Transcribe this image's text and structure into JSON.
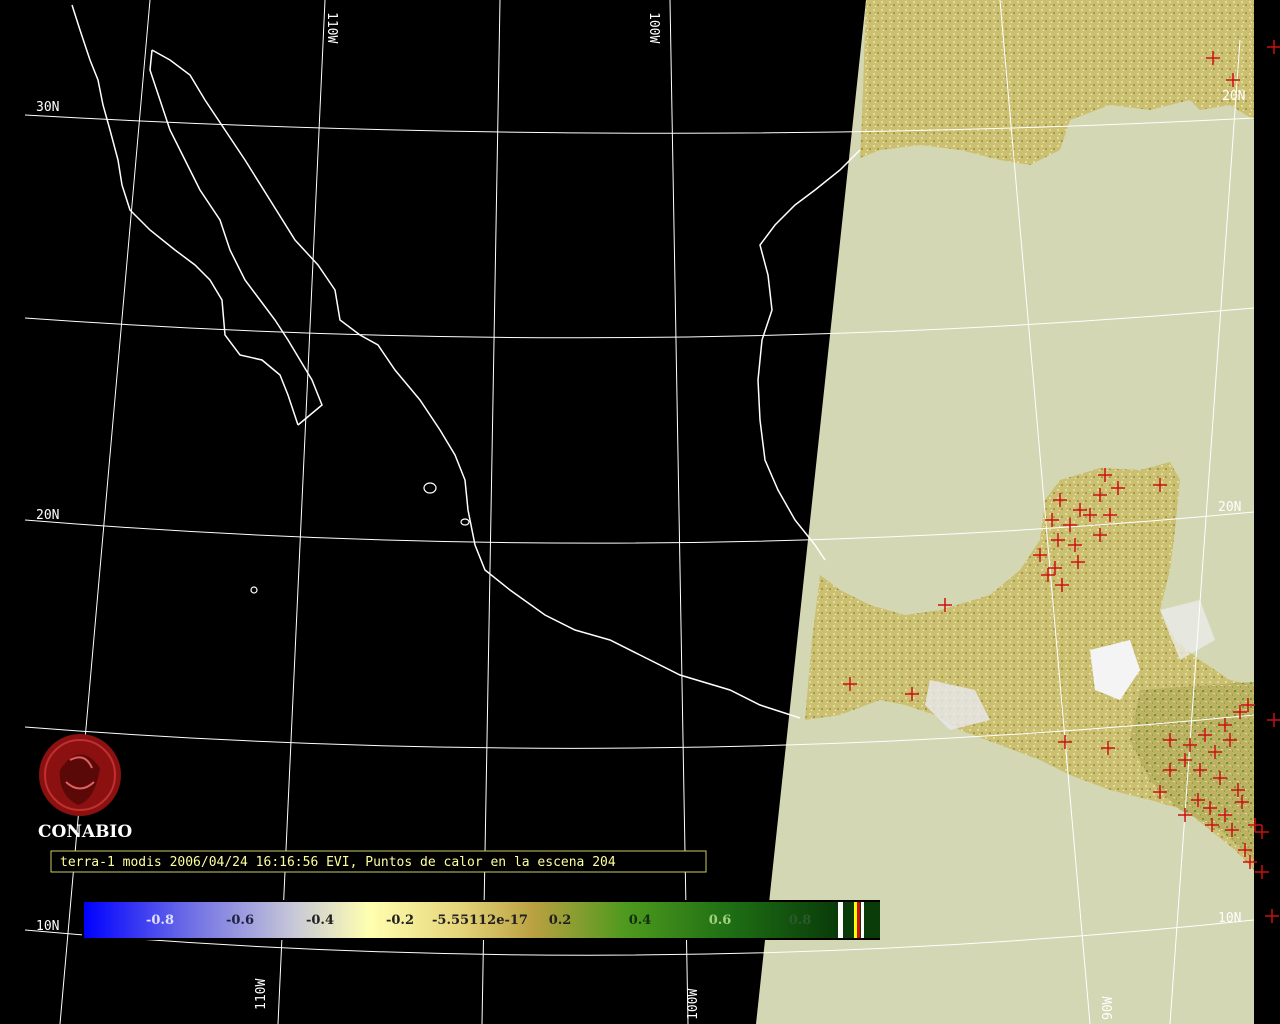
{
  "title": "terra-1 modis 2006/04/24 16:16:56 EVI, Puntos de calor en la escena 204",
  "logo_text": "CONABIO",
  "lat_labels": [
    "30N",
    "20N",
    "10N",
    "20N",
    "10N",
    "20N"
  ],
  "lon_labels": [
    "110W",
    "100W",
    "110W",
    "100W",
    "90W"
  ],
  "colorbar_ticks": [
    "-0.8",
    "-0.6",
    "-0.4",
    "-0.2",
    "-5.55112e-17",
    "0.2",
    "0.4",
    "0.6",
    "0.8"
  ],
  "colors": {
    "background": "#000000",
    "coastline": "#ffffff",
    "graticule": "#ffffff",
    "no_data": "#d3d7b3",
    "hotspot": "#cc1111",
    "title_text": "#ffff99",
    "logo": "#8b1010"
  }
}
